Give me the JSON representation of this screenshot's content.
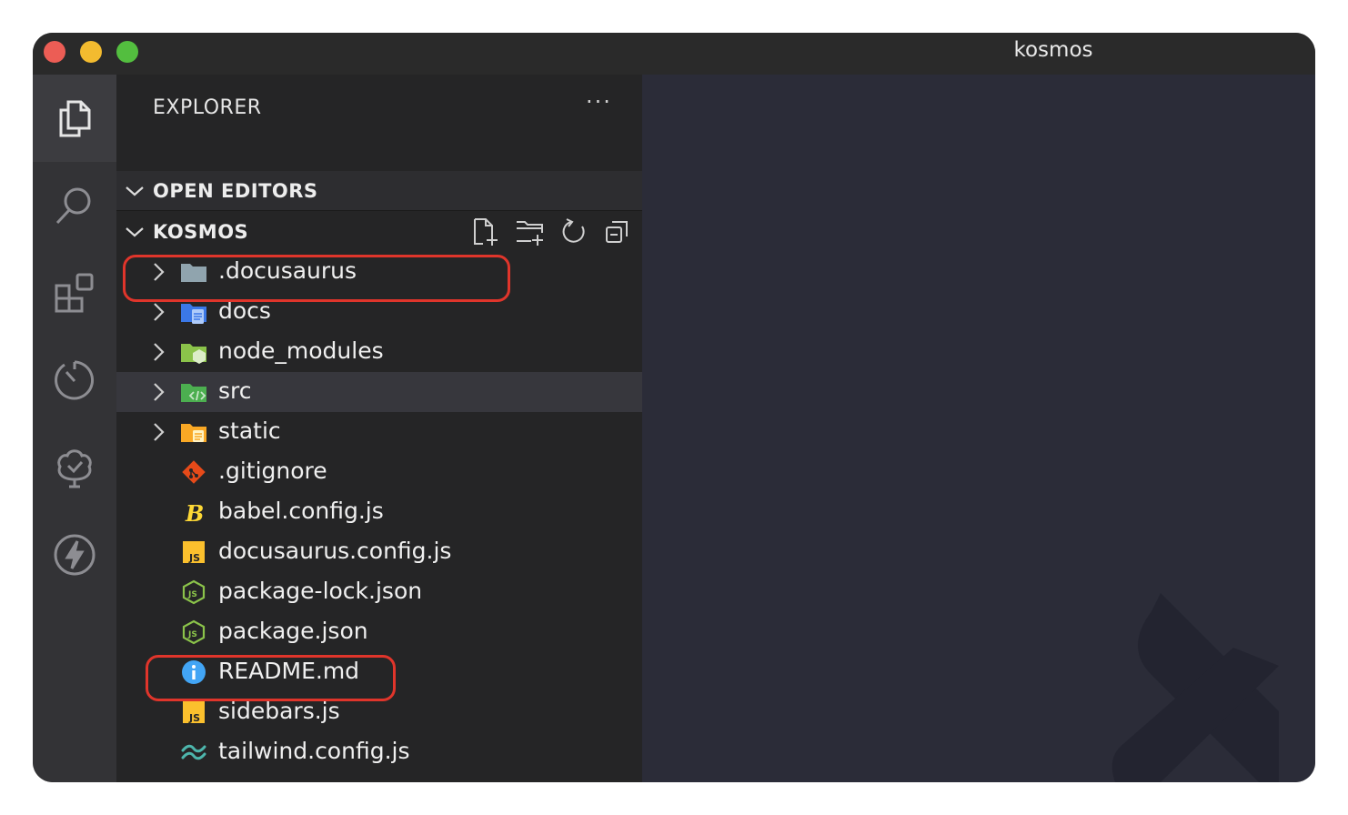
{
  "window": {
    "title": "kosmos"
  },
  "activity_bar": {
    "items": [
      {
        "name": "explorer",
        "icon": "files-icon",
        "active": true
      },
      {
        "name": "search",
        "icon": "search-icon",
        "active": false
      },
      {
        "name": "extensions",
        "icon": "extensions-icon",
        "active": false
      },
      {
        "name": "timer",
        "icon": "timer-icon",
        "active": false
      },
      {
        "name": "tree",
        "icon": "tree-check-icon",
        "active": false
      },
      {
        "name": "lightning",
        "icon": "lightning-icon",
        "active": false
      }
    ]
  },
  "sidebar": {
    "title": "EXPLORER",
    "more_label": "···",
    "sections": {
      "open_editors": "OPEN EDITORS",
      "project": "KOSMOS"
    },
    "project_actions": [
      "new-file-icon",
      "new-folder-icon",
      "refresh-icon",
      "collapse-all-icon"
    ],
    "tree": [
      {
        "label": ".docusaurus",
        "type": "folder",
        "icon": "folder-icon"
      },
      {
        "label": "docs",
        "type": "folder",
        "icon": "folder-docs-icon"
      },
      {
        "label": "node_modules",
        "type": "folder",
        "icon": "folder-node-icon"
      },
      {
        "label": "src",
        "type": "folder",
        "icon": "folder-src-icon",
        "selected": true
      },
      {
        "label": "static",
        "type": "folder",
        "icon": "folder-static-icon"
      },
      {
        "label": ".gitignore",
        "type": "file",
        "icon": "git-icon"
      },
      {
        "label": "babel.config.js",
        "type": "file",
        "icon": "babel-icon"
      },
      {
        "label": "docusaurus.config.js",
        "type": "file",
        "icon": "js-icon"
      },
      {
        "label": "package-lock.json",
        "type": "file",
        "icon": "nodejs-icon"
      },
      {
        "label": "package.json",
        "type": "file",
        "icon": "nodejs-icon"
      },
      {
        "label": "README.md",
        "type": "file",
        "icon": "info-icon"
      },
      {
        "label": "sidebars.js",
        "type": "file",
        "icon": "js-icon"
      },
      {
        "label": "tailwind.config.js",
        "type": "file",
        "icon": "tailwind-icon"
      }
    ]
  },
  "colors": {
    "highlight": "#e0352b",
    "selected_row": "#37373d",
    "editor_bg": "#2b2c38"
  }
}
